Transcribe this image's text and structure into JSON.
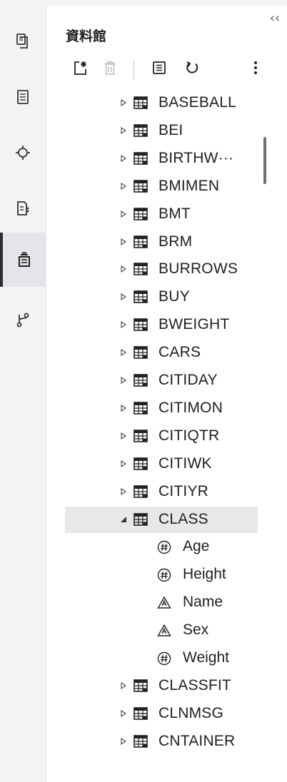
{
  "panel": {
    "title": "資料館",
    "collapse_glyph": "‹‹"
  },
  "rail": {
    "items": [
      {
        "name": "rail-explorer",
        "icon": "file-copy-icon",
        "active": false
      },
      {
        "name": "rail-open-items",
        "icon": "list-document-icon",
        "active": false
      },
      {
        "name": "rail-tasks",
        "icon": "snippet-circle-icon",
        "active": false
      },
      {
        "name": "rail-snippets",
        "icon": "document-code-icon",
        "active": false
      },
      {
        "name": "rail-libraries",
        "icon": "library-icon",
        "active": true
      },
      {
        "name": "rail-file-shortcuts",
        "icon": "branch-icon",
        "active": false
      }
    ]
  },
  "toolbar": {
    "buttons": [
      {
        "name": "new-library-button",
        "icon": "new-library-icon"
      },
      {
        "name": "delete-button",
        "icon": "trash-icon",
        "disabled": true
      },
      {
        "name": "view-properties-button",
        "icon": "properties-icon"
      },
      {
        "name": "refresh-button",
        "icon": "refresh-icon"
      },
      {
        "name": "more-options-button",
        "icon": "kebab-icon"
      }
    ]
  },
  "tree": {
    "tables": [
      {
        "label": "BASEBALL",
        "expanded": false
      },
      {
        "label": "BEI",
        "expanded": false
      },
      {
        "label": "BIRTHW···",
        "expanded": false
      },
      {
        "label": "BMIMEN",
        "expanded": false
      },
      {
        "label": "BMT",
        "expanded": false
      },
      {
        "label": "BRM",
        "expanded": false
      },
      {
        "label": "BURROWS",
        "expanded": false
      },
      {
        "label": "BUY",
        "expanded": false
      },
      {
        "label": "BWEIGHT",
        "expanded": false
      },
      {
        "label": "CARS",
        "expanded": false
      },
      {
        "label": "CITIDAY",
        "expanded": false
      },
      {
        "label": "CITIMON",
        "expanded": false
      },
      {
        "label": "CITIQTR",
        "expanded": false
      },
      {
        "label": "CITIWK",
        "expanded": false
      },
      {
        "label": "CITIYR",
        "expanded": false
      },
      {
        "label": "CLASS",
        "expanded": true,
        "selected": true
      },
      {
        "label": "CLASSFIT",
        "expanded": false
      },
      {
        "label": "CLNMSG",
        "expanded": false
      },
      {
        "label": "CNTAINER",
        "expanded": false
      }
    ],
    "class_columns": [
      {
        "label": "Age",
        "type": "numeric"
      },
      {
        "label": "Height",
        "type": "numeric"
      },
      {
        "label": "Name",
        "type": "character"
      },
      {
        "label": "Sex",
        "type": "character"
      },
      {
        "label": "Weight",
        "type": "numeric"
      }
    ]
  }
}
